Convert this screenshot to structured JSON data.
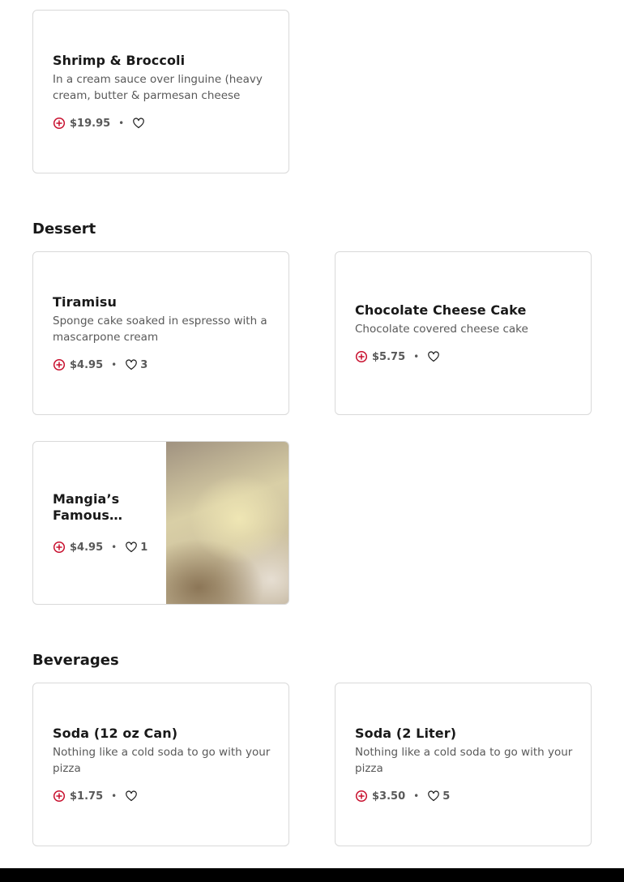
{
  "sections": {
    "dessert_title": "Dessert",
    "beverages_title": "Beverages"
  },
  "items": {
    "shrimp": {
      "title": "Shrimp & Broccoli",
      "desc": "In a cream sauce over linguine (heavy cream, butter & parmesan cheese",
      "price": "$19.95",
      "likes": ""
    },
    "tiramisu": {
      "title": "Tiramisu",
      "desc": "Sponge cake soaked in espresso with a mascarpone cream",
      "price": "$4.95",
      "likes": "3"
    },
    "choc_cake": {
      "title": "Chocolate Cheese Cake",
      "desc": "Chocolate covered cheese cake",
      "price": "$5.75",
      "likes": ""
    },
    "mangia": {
      "title": "Mangia’s Famous…",
      "price": "$4.95",
      "likes": "1"
    },
    "soda_can": {
      "title": "Soda (12 oz Can)",
      "desc": "Nothing like a cold soda to go with your pizza",
      "price": "$1.75",
      "likes": ""
    },
    "soda_liter": {
      "title": "Soda (2 Liter)",
      "desc": "Nothing like a cold soda to go with your pizza",
      "price": "$3.50",
      "likes": "5"
    }
  },
  "separator": "•",
  "icons": {
    "add": "plus-circle-icon",
    "like": "heart-icon"
  },
  "colors": {
    "accent": "#c8102e",
    "text": "#191919",
    "muted": "#595959",
    "border": "#d9d9d9",
    "footer": "#000000"
  }
}
